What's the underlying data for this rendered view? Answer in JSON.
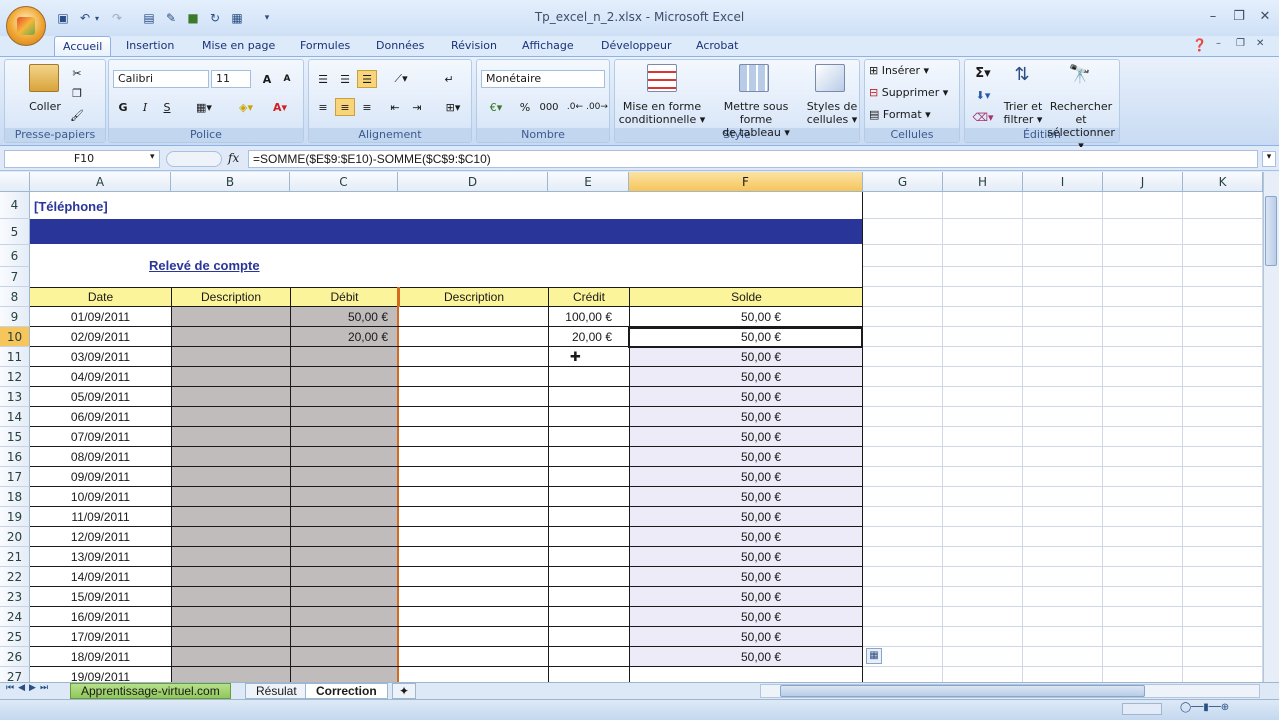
{
  "window": {
    "title": "Tp_excel_n_2.xlsx - Microsoft Excel"
  },
  "tabs": [
    "Accueil",
    "Insertion",
    "Mise en page",
    "Formules",
    "Données",
    "Révision",
    "Affichage",
    "Développeur",
    "Acrobat"
  ],
  "ribbon": {
    "clipboard": {
      "paste": "Coller",
      "label": "Presse-papiers"
    },
    "font": {
      "name": "Calibri",
      "size": "11",
      "bold": "G",
      "italic": "I",
      "underline": "S",
      "label": "Police"
    },
    "alignment": {
      "label": "Alignement"
    },
    "number": {
      "format": "Monétaire",
      "percent": "%",
      "thousands": "000",
      "label": "Nombre"
    },
    "styles": {
      "cond_format_1": "Mise en forme",
      "cond_format_2": "conditionnelle",
      "table_1": "Mettre sous forme",
      "table_2": "de tableau",
      "cell_styles_1": "Styles de",
      "cell_styles_2": "cellules",
      "label": "Style"
    },
    "cells": {
      "insert": "Insérer",
      "delete": "Supprimer",
      "format": "Format",
      "label": "Cellules"
    },
    "editing": {
      "sigma": "Σ",
      "sort_1": "Trier et",
      "sort_2": "filtrer",
      "find_1": "Rechercher et",
      "find_2": "sélectionner",
      "label": "Édition"
    }
  },
  "formula_bar": {
    "name_box": "F10",
    "fx": "fx",
    "formula": "=SOMME($E$9:$E10)-SOMME($C$9:$C10)"
  },
  "columns": [
    "A",
    "B",
    "C",
    "D",
    "E",
    "F",
    "G",
    "H",
    "I",
    "J",
    "K"
  ],
  "sheet": {
    "row4_title": "[Téléphone]",
    "heading": "Relevé de compte",
    "headers": {
      "date": "Date",
      "desc1": "Description",
      "debit": "Débit",
      "desc2": "Description",
      "credit": "Crédit",
      "solde": "Solde"
    },
    "rows": [
      {
        "num": "9",
        "date": "01/09/2011",
        "debit": "50,00 €",
        "credit": "100,00 €",
        "solde": "50,00 €"
      },
      {
        "num": "10",
        "date": "02/09/2011",
        "debit": "20,00 €",
        "credit": "20,00 €",
        "solde": "50,00 €"
      },
      {
        "num": "11",
        "date": "03/09/2011",
        "debit": "",
        "credit": "",
        "solde": "50,00 €"
      },
      {
        "num": "12",
        "date": "04/09/2011",
        "debit": "",
        "credit": "",
        "solde": "50,00 €"
      },
      {
        "num": "13",
        "date": "05/09/2011",
        "debit": "",
        "credit": "",
        "solde": "50,00 €"
      },
      {
        "num": "14",
        "date": "06/09/2011",
        "debit": "",
        "credit": "",
        "solde": "50,00 €"
      },
      {
        "num": "15",
        "date": "07/09/2011",
        "debit": "",
        "credit": "",
        "solde": "50,00 €"
      },
      {
        "num": "16",
        "date": "08/09/2011",
        "debit": "",
        "credit": "",
        "solde": "50,00 €"
      },
      {
        "num": "17",
        "date": "09/09/2011",
        "debit": "",
        "credit": "",
        "solde": "50,00 €"
      },
      {
        "num": "18",
        "date": "10/09/2011",
        "debit": "",
        "credit": "",
        "solde": "50,00 €"
      },
      {
        "num": "19",
        "date": "11/09/2011",
        "debit": "",
        "credit": "",
        "solde": "50,00 €"
      },
      {
        "num": "20",
        "date": "12/09/2011",
        "debit": "",
        "credit": "",
        "solde": "50,00 €"
      },
      {
        "num": "21",
        "date": "13/09/2011",
        "debit": "",
        "credit": "",
        "solde": "50,00 €"
      },
      {
        "num": "22",
        "date": "14/09/2011",
        "debit": "",
        "credit": "",
        "solde": "50,00 €"
      },
      {
        "num": "23",
        "date": "15/09/2011",
        "debit": "",
        "credit": "",
        "solde": "50,00 €"
      },
      {
        "num": "24",
        "date": "16/09/2011",
        "debit": "",
        "credit": "",
        "solde": "50,00 €"
      },
      {
        "num": "25",
        "date": "17/09/2011",
        "debit": "",
        "credit": "",
        "solde": "50,00 €"
      },
      {
        "num": "26",
        "date": "18/09/2011",
        "debit": "",
        "credit": "",
        "solde": "50,00 €"
      },
      {
        "num": "27",
        "date": "19/09/2011",
        "debit": "",
        "credit": "",
        "solde": ""
      }
    ],
    "top_row_nums": [
      "4",
      "5",
      "6",
      "7",
      "8"
    ]
  },
  "sheet_tabs": [
    "Apprentissage-virtuel.com",
    "Résulat",
    "Correction"
  ],
  "colors": {
    "header_yellow": "#fcf49a",
    "title_bar_blue": "#2a3599",
    "gray_fill": "#c0bcbc",
    "lavender": "#ecebf7",
    "accent_orange": "#d46a20"
  }
}
